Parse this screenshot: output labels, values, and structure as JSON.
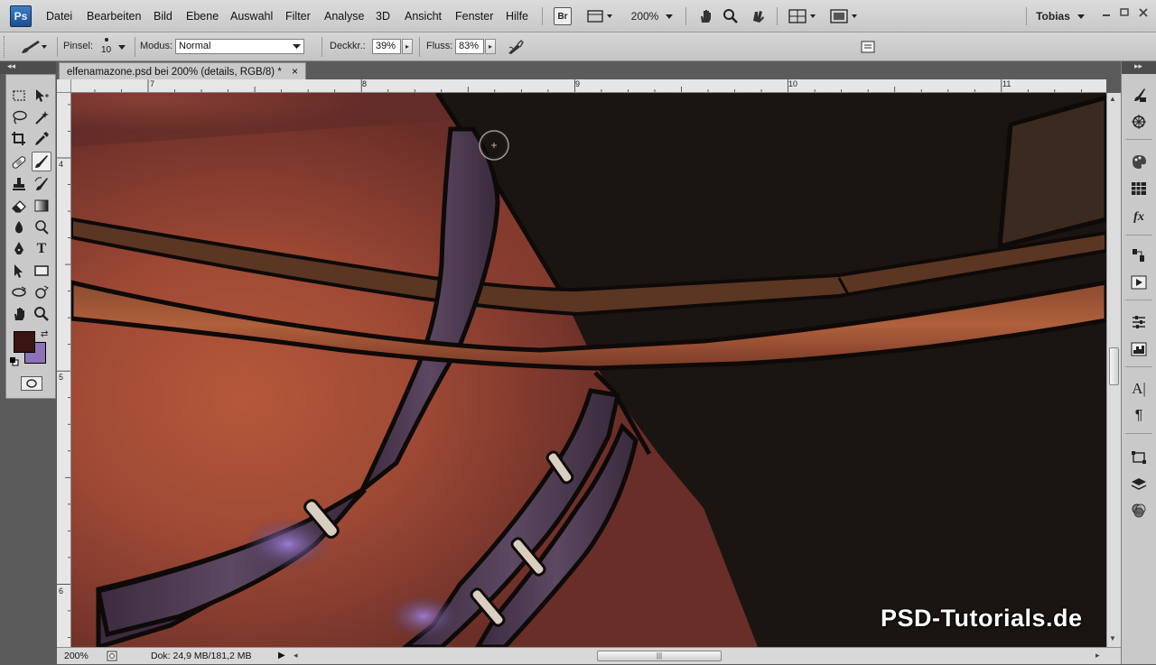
{
  "app": {
    "logo": "Ps",
    "user": "Tobias",
    "zoom": "200%"
  },
  "menu": [
    "Datei",
    "Bearbeiten",
    "Bild",
    "Ebene",
    "Auswahl",
    "Filter",
    "Analyse",
    "3D",
    "Ansicht",
    "Fenster",
    "Hilfe"
  ],
  "toolbar": {
    "bridge_label": "Br"
  },
  "options": {
    "brush_label": "Pinsel:",
    "brush_size": "10",
    "mode_label": "Modus:",
    "mode_value": "Normal",
    "opacity_label": "Deckkr.:",
    "opacity_value": "39%",
    "flow_label": "Fluss:",
    "flow_value": "83%"
  },
  "document": {
    "tab_title": "elfenamazone.psd bei 200% (details, RGB/8) *",
    "close_glyph": "×"
  },
  "rulers": {
    "top": [
      "7",
      "8",
      "9",
      "10",
      "11"
    ],
    "left": [
      "4",
      "5",
      "6"
    ]
  },
  "status": {
    "zoom": "200%",
    "doc_info": "Dok: 24,9 MB/181,2 MB"
  },
  "watermark": "PSD-Tutorials.de",
  "colors": {
    "foreground": "#3a1512",
    "background": "#8d72b5"
  }
}
